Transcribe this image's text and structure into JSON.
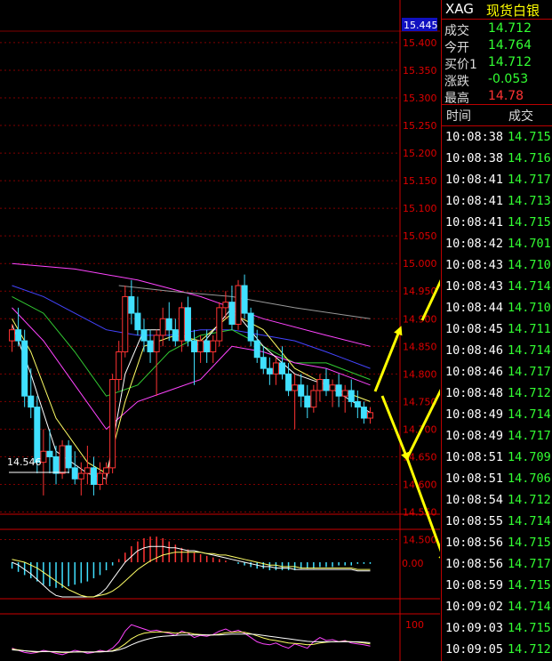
{
  "colors": {
    "up": "#ff3333",
    "down": "#40e0ff",
    "ma_white": "#ffffff",
    "ma_yellow": "#ffff66",
    "ma_green": "#33cc33",
    "ma_blue": "#4444ff",
    "ma_magenta": "#ff44ff",
    "ma_gray": "#999999",
    "grid": "#800000",
    "arrow": "#ffff00",
    "price_green": "#33ff33",
    "price_red": "#ff3333"
  },
  "header": {
    "symbol": "XAG",
    "name": "现货白银"
  },
  "quote": [
    {
      "label": "成交",
      "value": "14.712",
      "color": "#33ff33"
    },
    {
      "label": "今开",
      "value": "14.764",
      "color": "#33ff33"
    },
    {
      "label": "买价1",
      "value": "14.712",
      "color": "#33ff33"
    },
    {
      "label": "涨跌",
      "value": "-0.053",
      "color": "#33ff33"
    },
    {
      "label": "最高",
      "value": "14.78",
      "color": "#ff3333"
    }
  ],
  "ticks_header": {
    "time": "时间",
    "price": "成交"
  },
  "ticks": [
    {
      "time": "10:08:38",
      "price": "14.715"
    },
    {
      "time": "10:08:38",
      "price": "14.716"
    },
    {
      "time": "10:08:41",
      "price": "14.717"
    },
    {
      "time": "10:08:41",
      "price": "14.713"
    },
    {
      "time": "10:08:41",
      "price": "14.715"
    },
    {
      "time": "10:08:42",
      "price": "14.701"
    },
    {
      "time": "10:08:43",
      "price": "14.710"
    },
    {
      "time": "10:08:43",
      "price": "14.714"
    },
    {
      "time": "10:08:44",
      "price": "14.710"
    },
    {
      "time": "10:08:45",
      "price": "14.711"
    },
    {
      "time": "10:08:46",
      "price": "14.714"
    },
    {
      "time": "10:08:46",
      "price": "14.717"
    },
    {
      "time": "10:08:48",
      "price": "14.712"
    },
    {
      "time": "10:08:49",
      "price": "14.714"
    },
    {
      "time": "10:08:49",
      "price": "14.717"
    },
    {
      "time": "10:08:51",
      "price": "14.709"
    },
    {
      "time": "10:08:51",
      "price": "14.706"
    },
    {
      "time": "10:08:54",
      "price": "14.712"
    },
    {
      "time": "10:08:55",
      "price": "14.714"
    },
    {
      "time": "10:08:56",
      "price": "14.715"
    },
    {
      "time": "10:08:56",
      "price": "14.717"
    },
    {
      "time": "10:08:59",
      "price": "14.715"
    },
    {
      "time": "10:09:02",
      "price": "14.714"
    },
    {
      "time": "10:09:03",
      "price": "14.715"
    },
    {
      "time": "10:09:05",
      "price": "14.712"
    }
  ],
  "chart_data": {
    "type": "candlestick",
    "ylim": [
      14.546,
      15.445
    ],
    "y_ticks": [
      "15.400",
      "15.350",
      "15.300",
      "15.250",
      "15.200",
      "15.150",
      "15.100",
      "15.050",
      "15.000",
      "14.950",
      "14.900",
      "14.850",
      "14.800",
      "14.750",
      "14.700",
      "14.650",
      "14.600",
      "14.550",
      "14.500"
    ],
    "current_price_label": "15.445",
    "low_label": "14.546",
    "macd_zero_label": "0.00",
    "osc_top_label": "100",
    "candles": [
      [
        14.86,
        14.89,
        14.84,
        14.88
      ],
      [
        14.88,
        14.92,
        14.85,
        14.86
      ],
      [
        14.86,
        14.88,
        14.74,
        14.76
      ],
      [
        14.76,
        14.81,
        14.72,
        14.74
      ],
      [
        14.74,
        14.76,
        14.62,
        14.64
      ],
      [
        14.64,
        14.7,
        14.58,
        14.66
      ],
      [
        14.66,
        14.7,
        14.62,
        14.65
      ],
      [
        14.65,
        14.67,
        14.6,
        14.62
      ],
      [
        14.62,
        14.68,
        14.61,
        14.67
      ],
      [
        14.67,
        14.68,
        14.62,
        14.63
      ],
      [
        14.63,
        14.66,
        14.6,
        14.61
      ],
      [
        14.61,
        14.64,
        14.58,
        14.62
      ],
      [
        14.62,
        14.67,
        14.6,
        14.63
      ],
      [
        14.63,
        14.65,
        14.58,
        14.6
      ],
      [
        14.6,
        14.64,
        14.59,
        14.62
      ],
      [
        14.62,
        14.64,
        14.6,
        14.63
      ],
      [
        14.63,
        14.8,
        14.62,
        14.79
      ],
      [
        14.79,
        14.86,
        14.77,
        14.84
      ],
      [
        14.84,
        14.96,
        14.83,
        14.94
      ],
      [
        14.94,
        14.97,
        14.89,
        14.91
      ],
      [
        14.91,
        14.94,
        14.87,
        14.88
      ],
      [
        14.88,
        14.9,
        14.84,
        14.86
      ],
      [
        14.86,
        14.88,
        14.82,
        14.84
      ],
      [
        14.84,
        14.88,
        14.76,
        14.87
      ],
      [
        14.87,
        14.92,
        14.85,
        14.9
      ],
      [
        14.9,
        14.93,
        14.86,
        14.88
      ],
      [
        14.88,
        14.9,
        14.85,
        14.86
      ],
      [
        14.86,
        14.93,
        14.84,
        14.92
      ],
      [
        14.92,
        14.94,
        14.85,
        14.86
      ],
      [
        14.86,
        14.88,
        14.78,
        14.84
      ],
      [
        14.84,
        14.87,
        14.82,
        14.86
      ],
      [
        14.86,
        14.88,
        14.82,
        14.84
      ],
      [
        14.84,
        14.87,
        14.82,
        14.86
      ],
      [
        14.86,
        14.93,
        14.85,
        14.92
      ],
      [
        14.92,
        14.95,
        14.9,
        14.93
      ],
      [
        14.93,
        14.96,
        14.88,
        14.89
      ],
      [
        14.89,
        14.97,
        14.88,
        14.96
      ],
      [
        14.96,
        14.98,
        14.9,
        14.91
      ],
      [
        14.91,
        14.92,
        14.85,
        14.86
      ],
      [
        14.86,
        14.88,
        14.82,
        14.83
      ],
      [
        14.83,
        14.85,
        14.8,
        14.81
      ],
      [
        14.81,
        14.83,
        14.78,
        14.8
      ],
      [
        14.8,
        14.83,
        14.78,
        14.82
      ],
      [
        14.82,
        14.85,
        14.79,
        14.8
      ],
      [
        14.8,
        14.82,
        14.76,
        14.77
      ],
      [
        14.77,
        14.8,
        14.7,
        14.78
      ],
      [
        14.78,
        14.8,
        14.74,
        14.76
      ],
      [
        14.76,
        14.78,
        14.72,
        14.74
      ],
      [
        14.74,
        14.78,
        14.73,
        14.77
      ],
      [
        14.77,
        14.8,
        14.75,
        14.79
      ],
      [
        14.79,
        14.81,
        14.76,
        14.77
      ],
      [
        14.77,
        14.79,
        14.74,
        14.78
      ],
      [
        14.78,
        14.8,
        14.74,
        14.76
      ],
      [
        14.76,
        14.78,
        14.73,
        14.77
      ],
      [
        14.77,
        14.79,
        14.74,
        14.75
      ],
      [
        14.75,
        14.77,
        14.72,
        14.74
      ],
      [
        14.74,
        14.75,
        14.71,
        14.72
      ],
      [
        14.72,
        14.74,
        14.71,
        14.73
      ]
    ],
    "ma_lines": [
      {
        "name": "magenta_long",
        "color": "#ff44ff",
        "points": [
          [
            0,
            15.0
          ],
          [
            10,
            14.99
          ],
          [
            20,
            14.97
          ],
          [
            30,
            14.94
          ],
          [
            40,
            14.9
          ],
          [
            50,
            14.87
          ],
          [
            57,
            14.85
          ]
        ]
      },
      {
        "name": "gray",
        "color": "#999999",
        "points": [
          [
            17,
            14.96
          ],
          [
            25,
            14.95
          ],
          [
            35,
            14.94
          ],
          [
            45,
            14.92
          ],
          [
            57,
            14.9
          ]
        ]
      },
      {
        "name": "blue",
        "color": "#4444ff",
        "points": [
          [
            0,
            14.96
          ],
          [
            5,
            14.94
          ],
          [
            10,
            14.91
          ],
          [
            15,
            14.88
          ],
          [
            20,
            14.87
          ],
          [
            25,
            14.87
          ],
          [
            30,
            14.88
          ],
          [
            35,
            14.88
          ],
          [
            40,
            14.87
          ],
          [
            45,
            14.86
          ],
          [
            50,
            14.84
          ],
          [
            57,
            14.81
          ]
        ]
      },
      {
        "name": "green",
        "color": "#33cc33",
        "points": [
          [
            0,
            14.94
          ],
          [
            5,
            14.91
          ],
          [
            10,
            14.84
          ],
          [
            15,
            14.76
          ],
          [
            20,
            14.78
          ],
          [
            25,
            14.84
          ],
          [
            30,
            14.87
          ],
          [
            35,
            14.88
          ],
          [
            40,
            14.85
          ],
          [
            45,
            14.82
          ],
          [
            50,
            14.82
          ],
          [
            57,
            14.79
          ]
        ]
      },
      {
        "name": "magenta_short",
        "color": "#ff44ff",
        "points": [
          [
            0,
            14.92
          ],
          [
            5,
            14.86
          ],
          [
            10,
            14.78
          ],
          [
            15,
            14.7
          ],
          [
            20,
            14.75
          ],
          [
            25,
            14.77
          ],
          [
            30,
            14.79
          ],
          [
            35,
            14.85
          ],
          [
            40,
            14.84
          ],
          [
            45,
            14.82
          ],
          [
            50,
            14.81
          ],
          [
            57,
            14.78
          ]
        ]
      },
      {
        "name": "yellow",
        "color": "#ffff66",
        "points": [
          [
            0,
            14.9
          ],
          [
            3,
            14.84
          ],
          [
            7,
            14.72
          ],
          [
            12,
            14.64
          ],
          [
            15,
            14.62
          ],
          [
            18,
            14.75
          ],
          [
            21,
            14.85
          ],
          [
            26,
            14.87
          ],
          [
            30,
            14.86
          ],
          [
            35,
            14.91
          ],
          [
            40,
            14.88
          ],
          [
            45,
            14.81
          ],
          [
            50,
            14.78
          ],
          [
            57,
            14.75
          ]
        ]
      },
      {
        "name": "white",
        "color": "#ffffff",
        "points": [
          [
            0,
            14.89
          ],
          [
            3,
            14.8
          ],
          [
            7,
            14.66
          ],
          [
            12,
            14.62
          ],
          [
            15,
            14.61
          ],
          [
            18,
            14.8
          ],
          [
            21,
            14.88
          ],
          [
            26,
            14.88
          ],
          [
            30,
            14.85
          ],
          [
            35,
            14.92
          ],
          [
            40,
            14.85
          ],
          [
            45,
            14.8
          ],
          [
            50,
            14.78
          ],
          [
            57,
            14.73
          ]
        ]
      }
    ],
    "macd_hist": [
      -4,
      -6,
      -8,
      -10,
      -12,
      -14,
      -15,
      -16,
      -16,
      -15,
      -14,
      -13,
      -12,
      -10,
      -8,
      -5,
      -2,
      2,
      6,
      10,
      13,
      15,
      16,
      16,
      15,
      13,
      11,
      9,
      8,
      6,
      5,
      4,
      3,
      2,
      1,
      0,
      -1,
      -2,
      -3,
      -4,
      -4,
      -5,
      -5,
      -5,
      -5,
      -5,
      -4,
      -4,
      -4,
      -3,
      -3,
      -3,
      -2,
      -2,
      -2,
      -1,
      -1,
      -1
    ],
    "macd_lines": [
      {
        "color": "#ffffff",
        "values": [
          0,
          -2,
          -5,
          -8,
          -12,
          -16,
          -20,
          -23,
          -25,
          -27,
          -28,
          -28,
          -27,
          -25,
          -22,
          -18,
          -12,
          -6,
          0,
          4,
          8,
          10,
          11,
          11,
          11,
          10,
          10,
          9,
          8,
          8,
          7,
          6,
          5,
          4,
          3,
          2,
          1,
          0,
          -1,
          -2,
          -3,
          -3,
          -4,
          -4,
          -4,
          -5,
          -5,
          -5,
          -5,
          -5,
          -5,
          -5,
          -5,
          -5,
          -5,
          -6,
          -6,
          -6
        ]
      },
      {
        "color": "#ffff66",
        "values": [
          2,
          1,
          0,
          -2,
          -4,
          -7,
          -10,
          -13,
          -16,
          -19,
          -21,
          -23,
          -24,
          -24,
          -23,
          -22,
          -20,
          -17,
          -13,
          -9,
          -5,
          -2,
          1,
          3,
          5,
          6,
          7,
          7,
          7,
          7,
          7,
          6,
          6,
          5,
          5,
          4,
          3,
          2,
          1,
          0,
          -1,
          -2,
          -2,
          -3,
          -3,
          -3,
          -4,
          -4,
          -4,
          -4,
          -4,
          -4,
          -4,
          -4,
          -4,
          -5,
          -5,
          -5
        ]
      }
    ],
    "osc_lines": [
      {
        "color": "#ff44ff",
        "values": [
          30,
          25,
          20,
          18,
          20,
          25,
          22,
          18,
          15,
          20,
          25,
          22,
          18,
          20,
          25,
          22,
          30,
          45,
          70,
          85,
          80,
          75,
          70,
          72,
          68,
          65,
          60,
          70,
          65,
          55,
          60,
          58,
          62,
          70,
          75,
          68,
          72,
          65,
          55,
          45,
          40,
          38,
          42,
          35,
          30,
          40,
          35,
          30,
          45,
          55,
          48,
          50,
          45,
          48,
          42,
          40,
          38,
          35
        ]
      },
      {
        "color": "#ffff66",
        "values": [
          28,
          26,
          24,
          22,
          21,
          22,
          22,
          21,
          20,
          20,
          21,
          22,
          21,
          21,
          22,
          22,
          24,
          30,
          40,
          52,
          60,
          65,
          67,
          68,
          68,
          67,
          65,
          66,
          66,
          63,
          62,
          61,
          61,
          63,
          66,
          67,
          68,
          67,
          64,
          59,
          54,
          50,
          48,
          45,
          42,
          41,
          40,
          38,
          39,
          42,
          44,
          45,
          45,
          46,
          45,
          44,
          42,
          40
        ]
      },
      {
        "color": "#ffffff",
        "values": [
          26,
          25,
          24,
          23,
          22,
          22,
          22,
          22,
          21,
          21,
          21,
          21,
          21,
          21,
          21,
          22,
          23,
          26,
          31,
          38,
          44,
          49,
          53,
          56,
          58,
          59,
          60,
          61,
          61,
          61,
          61,
          61,
          61,
          61,
          62,
          63,
          63,
          63,
          63,
          62,
          60,
          58,
          56,
          54,
          52,
          50,
          48,
          46,
          45,
          45,
          45,
          45,
          45,
          45,
          45,
          45,
          44,
          43
        ]
      }
    ]
  }
}
